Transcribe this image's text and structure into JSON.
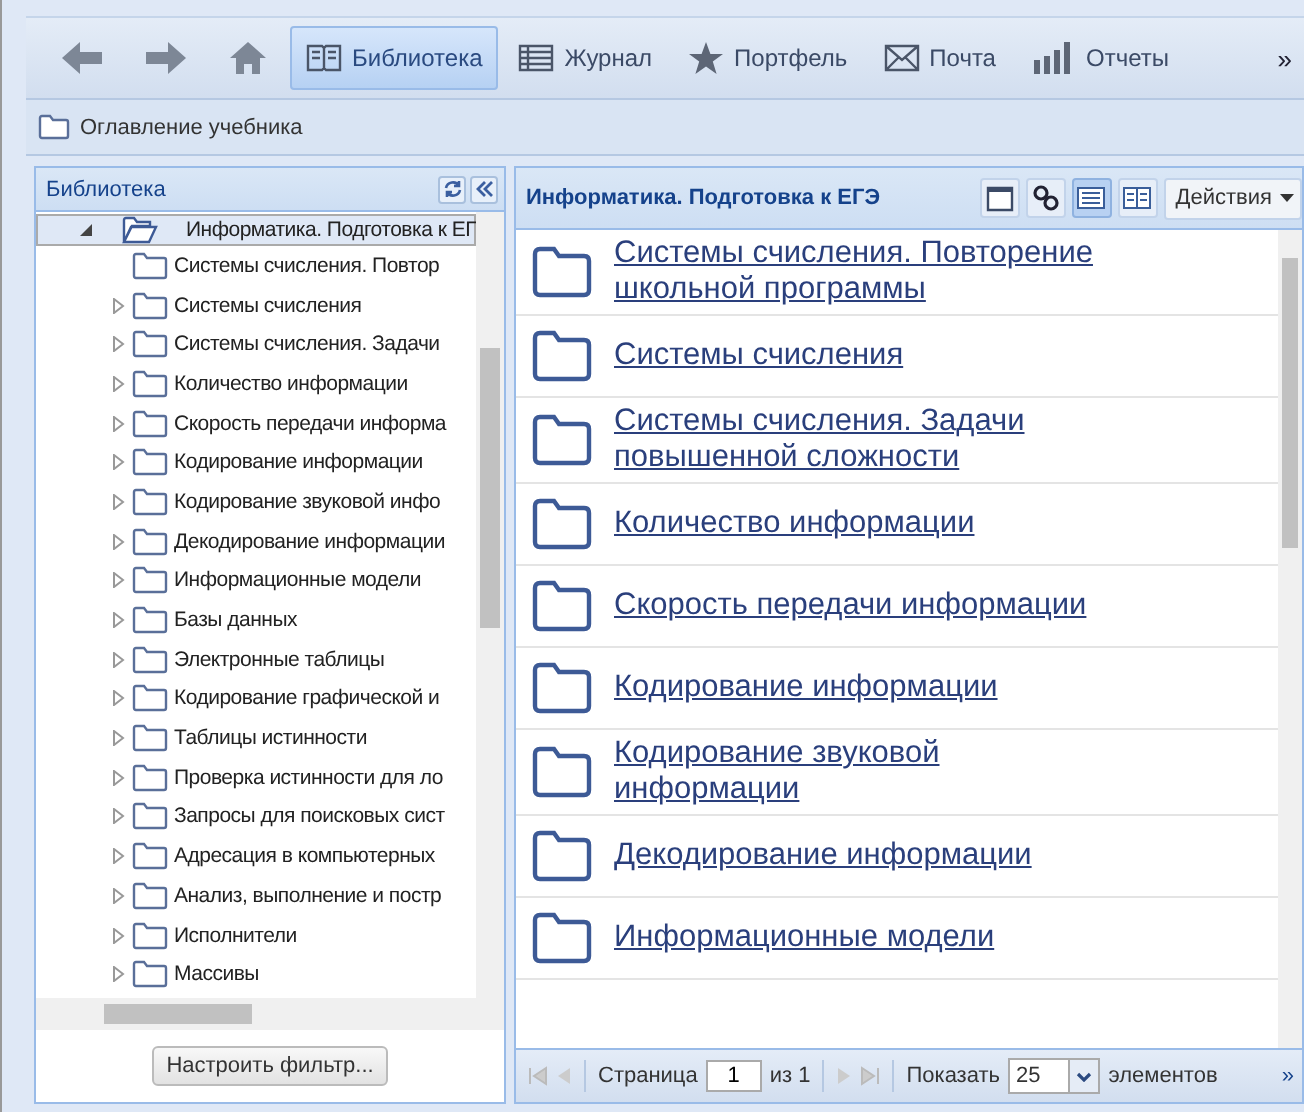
{
  "toolbar": {
    "items": [
      {
        "kind": "back",
        "selected": false
      },
      {
        "kind": "forward",
        "selected": false
      },
      {
        "kind": "home",
        "selected": false
      },
      {
        "kind": "book",
        "label": "Библиотека",
        "selected": true
      },
      {
        "kind": "table",
        "label": "Журнал",
        "selected": false
      },
      {
        "kind": "star",
        "label": "Портфель",
        "selected": false
      },
      {
        "kind": "mail",
        "label": "Почта",
        "selected": false
      },
      {
        "kind": "chart",
        "label": "Отчеты",
        "selected": false
      }
    ],
    "overflow": "»"
  },
  "breadcrumb": {
    "label": "Оглавление учебника"
  },
  "library": {
    "title": "Библиотека",
    "tree": [
      {
        "label": "Информатика. Подготовка к ЕГ",
        "expandable": true,
        "expanded": true,
        "selected": true,
        "children": [
          {
            "label": "Системы счисления. Повтор",
            "expandable": false,
            "expanded": false,
            "selected": false
          },
          {
            "label": "Системы счисления",
            "expandable": true,
            "expanded": false,
            "selected": false
          },
          {
            "label": "Системы счисления. Задачи",
            "expandable": true,
            "expanded": false,
            "selected": false
          },
          {
            "label": "Количество информации",
            "expandable": true,
            "expanded": false,
            "selected": false
          },
          {
            "label": "Скорость передачи информа",
            "expandable": true,
            "expanded": false,
            "selected": false
          },
          {
            "label": "Кодирование информации",
            "expandable": true,
            "expanded": false,
            "selected": false
          },
          {
            "label": "Кодирование звуковой инфо",
            "expandable": true,
            "expanded": false,
            "selected": false
          },
          {
            "label": "Декодирование информации",
            "expandable": true,
            "expanded": false,
            "selected": false
          },
          {
            "label": "Информационные модели",
            "expandable": true,
            "expanded": false,
            "selected": false
          },
          {
            "label": "Базы данных",
            "expandable": true,
            "expanded": false,
            "selected": false
          },
          {
            "label": "Электронные таблицы",
            "expandable": true,
            "expanded": false,
            "selected": false
          },
          {
            "label": "Кодирование графической и",
            "expandable": true,
            "expanded": false,
            "selected": false
          },
          {
            "label": "Таблицы истинности",
            "expandable": true,
            "expanded": false,
            "selected": false
          },
          {
            "label": "Проверка истинности для ло",
            "expandable": true,
            "expanded": false,
            "selected": false
          },
          {
            "label": "Запросы для поисковых сист",
            "expandable": true,
            "expanded": false,
            "selected": false
          },
          {
            "label": "Адресация в компьютерных",
            "expandable": true,
            "expanded": false,
            "selected": false
          },
          {
            "label": "Анализ, выполнение и постр",
            "expandable": true,
            "expanded": false,
            "selected": false
          },
          {
            "label": "Исполнители",
            "expandable": true,
            "expanded": false,
            "selected": false
          },
          {
            "label": "Массивы",
            "expandable": true,
            "expanded": false,
            "selected": false
          }
        ]
      }
    ],
    "filter_button": "Настроить фильтр..."
  },
  "content": {
    "title": "Информатика. Подготовка к ЕГЭ",
    "views": [
      {
        "kind": "single",
        "selected": false
      },
      {
        "kind": "links",
        "selected": false
      },
      {
        "kind": "list",
        "selected": true
      },
      {
        "kind": "tiles",
        "selected": false
      }
    ],
    "actions_button": "Действия",
    "items": [
      {
        "label": "Системы счисления. Повторение школьной программы"
      },
      {
        "label": "Системы счисления"
      },
      {
        "label": "Системы счисления. Задачи повышенной сложности"
      },
      {
        "label": "Количество информации"
      },
      {
        "label": "Скорость передачи информации"
      },
      {
        "label": "Кодирование информации"
      },
      {
        "label": "Кодирование звуковой информации"
      },
      {
        "label": "Декодирование информации"
      },
      {
        "label": "Информационные модели"
      }
    ],
    "pager": {
      "page_label": "Страница",
      "page": "1",
      "of_label": "из 1",
      "show_label": "Показать",
      "page_size": "25",
      "items_label": "элементов",
      "overflow": "»"
    }
  }
}
